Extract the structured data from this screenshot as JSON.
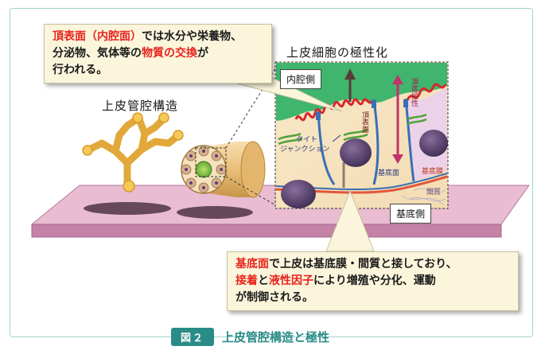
{
  "callout_top": {
    "line1_red": "頂表面（内腔面）",
    "line1_rest": "では水分や栄養物、",
    "line2": "分泌物、気体等の",
    "line2_red": "物質の交換",
    "line2_end": "が",
    "line3": "行われる。"
  },
  "heading_structure": "上皮管腔構造",
  "heading_polarity": "上皮細胞の極性化",
  "labels": {
    "lumen_side": "内腔側",
    "basal_side": "基底側",
    "apical_surface": "頂表面",
    "apicobasal_polarity": "頂底極性",
    "tight_junction_1": "タイト",
    "tight_junction_2": "ジャンクション",
    "basal_surface": "基底面",
    "basement_membrane": "基底膜",
    "stroma": "間質"
  },
  "callout_bottom": {
    "line1_red": "基底面",
    "line1_rest": "で上皮は基底膜・間質と接しており、",
    "line2_red1": "接着",
    "line2_mid": "と",
    "line2_red2": "液性因子",
    "line2_rest": "により増殖や分化、運動",
    "line3": "が制御される。"
  },
  "caption": {
    "badge": "図２",
    "title": "上皮管腔構造と極性"
  },
  "colors": {
    "accent": "#2a8c88",
    "highlight_red": "#e8231c",
    "callout_bg": "#fbf5dc",
    "platform": "#d7a2c0",
    "apical_membrane": "#d9262b",
    "basal_membrane": "#3a6fb5"
  }
}
